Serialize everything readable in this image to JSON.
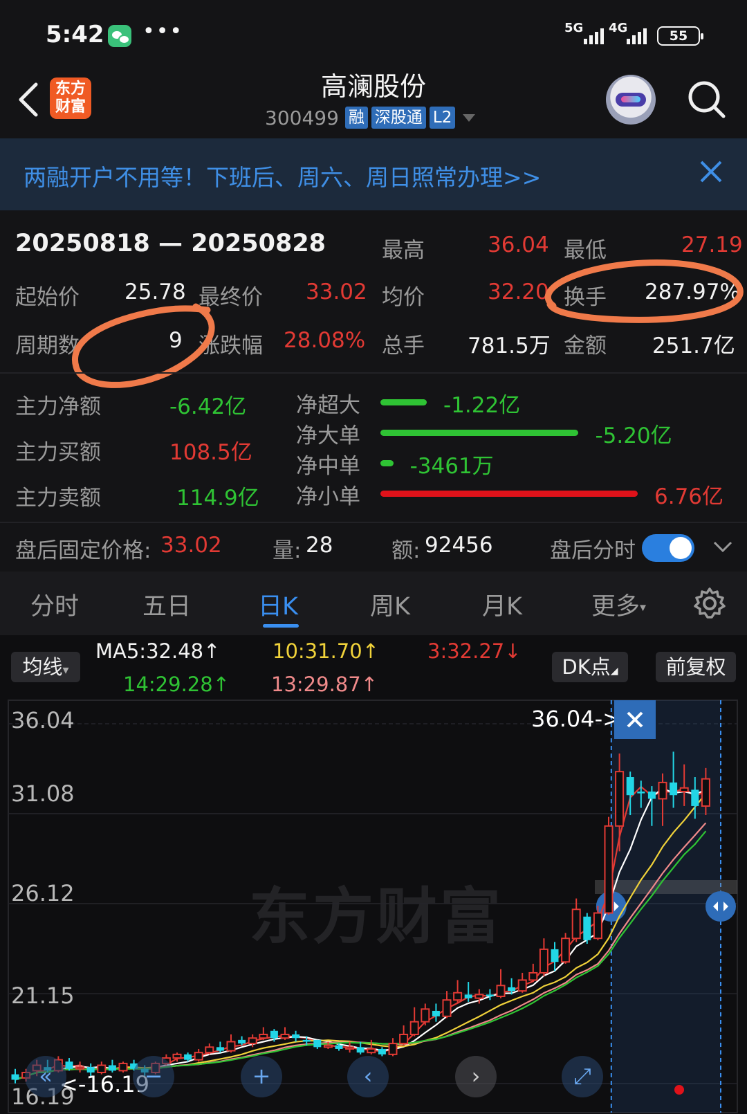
{
  "status_bar": {
    "time": "5:42",
    "more": "•••",
    "net1": "5G",
    "net2": "4G",
    "battery": "55"
  },
  "header": {
    "logo_text_1": "东方",
    "logo_text_2": "财富",
    "title": "高澜股份",
    "code": "300499",
    "tags": [
      "融",
      "深股通",
      "L2"
    ]
  },
  "banner": {
    "text": "两融开户不用等！下班后、周六、周日照常办理>>"
  },
  "stats": {
    "range": "20250818 — 20250828",
    "high_label": "最高",
    "high": "36.04",
    "low_label": "最低",
    "low": "27.19",
    "start_label": "起始价",
    "start": "25.78",
    "end_label": "最终价",
    "end": "33.02",
    "avg_label": "均价",
    "avg": "32.20",
    "turnover_label": "换手",
    "turnover": "287.97%",
    "periods_label": "周期数",
    "periods": "9",
    "change_label": "涨跌幅",
    "change": "28.08%",
    "volume_label": "总手",
    "volume": "781.5万",
    "amount_label": "金额",
    "amount": "251.7亿"
  },
  "flows": {
    "net_label": "主力净额",
    "net": "-6.42亿",
    "buy_label": "主力买额",
    "buy": "108.5亿",
    "sell_label": "主力卖额",
    "sell": "114.9亿",
    "items": [
      {
        "label": "净超大",
        "value": "-1.22亿",
        "fraction": 0.18,
        "color": "#2fc334"
      },
      {
        "label": "净大单",
        "value": "-5.20亿",
        "fraction": 0.77,
        "color": "#2fc334"
      },
      {
        "label": "净中单",
        "value": "-3461万",
        "fraction": 0.05,
        "color": "#2fc334"
      },
      {
        "label": "净小单",
        "value": "6.76亿",
        "fraction": 1.0,
        "color": "#e0121a"
      }
    ]
  },
  "after_hours": {
    "price_label": "盘后固定价格:",
    "price": "33.02",
    "vol_label": "量:",
    "vol": "28",
    "amt_label": "额:",
    "amt": "92456",
    "toggle_label": "盘后分时",
    "toggle_on": true
  },
  "tabs": [
    "分时",
    "五日",
    "日K",
    "周K",
    "月K",
    "更多"
  ],
  "active_tab": "日K",
  "chart_controls": {
    "ma_button": "均线",
    "dk_button": "DK点",
    "adjust_button": "前复权",
    "ma5": "MA5:32.48",
    "ma5_arrow": "↑",
    "ma10": "10:31.70",
    "ma10_arrow": "↑",
    "ma3": "3:32.27",
    "ma3_arrow": "↓",
    "ma14": "14:29.28",
    "ma14_arrow": "↑",
    "ma13": "13:29.87",
    "ma13_arrow": "↑"
  },
  "chart_data": {
    "type": "candlestick",
    "y_ticks": [
      "36.04",
      "31.08",
      "26.12",
      "21.15",
      "16.19"
    ],
    "ylim": [
      16.19,
      36.04
    ],
    "high_marker": "36.04->",
    "low_marker": "<-16.19",
    "watermark": "东方财富",
    "candles": [
      [
        16.7,
        16.4,
        17.0,
        16.2
      ],
      [
        16.5,
        16.8,
        17.0,
        16.3
      ],
      [
        16.9,
        17.2,
        17.5,
        16.6
      ],
      [
        17.1,
        16.9,
        17.5,
        16.8
      ],
      [
        16.9,
        17.5,
        17.7,
        16.8
      ],
      [
        17.4,
        17.0,
        17.6,
        16.9
      ],
      [
        17.0,
        17.1,
        17.4,
        16.8
      ],
      [
        17.1,
        16.8,
        17.3,
        16.6
      ],
      [
        16.8,
        17.2,
        17.4,
        16.7
      ],
      [
        17.2,
        16.9,
        17.5,
        16.8
      ],
      [
        16.9,
        17.3,
        17.4,
        16.8
      ],
      [
        17.3,
        17.0,
        17.5,
        16.9
      ],
      [
        17.0,
        16.8,
        17.2,
        16.6
      ],
      [
        16.8,
        17.3,
        17.4,
        16.7
      ],
      [
        17.3,
        17.6,
        17.8,
        17.2
      ],
      [
        17.6,
        17.8,
        17.9,
        17.4
      ],
      [
        17.8,
        17.5,
        17.9,
        17.4
      ],
      [
        17.5,
        17.9,
        18.1,
        17.4
      ],
      [
        17.9,
        18.2,
        18.4,
        17.8
      ],
      [
        18.2,
        18.0,
        18.5,
        17.9
      ],
      [
        18.0,
        18.5,
        18.9,
        17.9
      ],
      [
        18.6,
        18.4,
        18.8,
        18.3
      ],
      [
        18.4,
        18.7,
        18.9,
        18.2
      ],
      [
        18.7,
        18.9,
        19.3,
        18.6
      ],
      [
        19.1,
        18.7,
        19.2,
        18.5
      ],
      [
        18.7,
        18.9,
        19.3,
        18.6
      ],
      [
        18.9,
        18.7,
        19.1,
        18.5
      ],
      [
        18.6,
        18.5,
        18.8,
        18.3
      ],
      [
        18.6,
        18.2,
        18.6,
        18.1
      ],
      [
        18.2,
        18.3,
        18.5,
        18.1
      ],
      [
        18.3,
        18.1,
        18.4,
        18.0
      ],
      [
        18.1,
        18.2,
        18.5,
        17.9
      ],
      [
        18.2,
        17.9,
        18.5,
        17.8
      ],
      [
        17.9,
        18.1,
        18.6,
        17.8
      ],
      [
        18.1,
        17.8,
        18.2,
        17.7
      ],
      [
        17.8,
        18.4,
        18.7,
        17.7
      ],
      [
        18.4,
        18.9,
        19.4,
        18.3
      ],
      [
        18.9,
        19.6,
        20.4,
        18.8
      ],
      [
        19.6,
        20.3,
        20.6,
        19.4
      ],
      [
        20.2,
        19.9,
        20.6,
        19.6
      ],
      [
        19.9,
        20.8,
        21.3,
        19.8
      ],
      [
        20.8,
        21.2,
        21.9,
        20.6
      ],
      [
        21.1,
        20.9,
        21.8,
        20.7
      ],
      [
        20.9,
        21.1,
        21.4,
        20.6
      ],
      [
        21.1,
        21.0,
        21.4,
        20.8
      ],
      [
        21.0,
        21.6,
        22.5,
        20.9
      ],
      [
        21.5,
        21.3,
        22.0,
        21.1
      ],
      [
        21.3,
        21.9,
        22.3,
        21.2
      ],
      [
        21.9,
        22.3,
        22.8,
        21.8
      ],
      [
        22.3,
        23.6,
        24.2,
        22.1
      ],
      [
        23.6,
        22.9,
        24.0,
        22.4
      ],
      [
        22.9,
        24.2,
        24.5,
        22.8
      ],
      [
        24.2,
        25.8,
        26.4,
        24.0
      ],
      [
        25.4,
        24.1,
        25.6,
        23.9
      ],
      [
        24.2,
        25.6,
        26.0,
        24.1
      ],
      [
        25.6,
        30.4,
        30.9,
        25.5
      ],
      [
        30.4,
        33.4,
        34.4,
        29.0
      ],
      [
        33.1,
        32.1,
        33.4,
        31.0
      ],
      [
        32.3,
        32.2,
        32.9,
        31.4
      ],
      [
        32.3,
        31.9,
        32.6,
        30.4
      ],
      [
        31.9,
        32.8,
        33.3,
        30.4
      ],
      [
        32.8,
        32.1,
        34.5,
        31.4
      ],
      [
        32.3,
        32.5,
        33.8,
        31.5
      ],
      [
        32.4,
        31.5,
        33.1,
        30.8
      ],
      [
        31.5,
        33.0,
        33.6,
        31.0
      ]
    ]
  }
}
